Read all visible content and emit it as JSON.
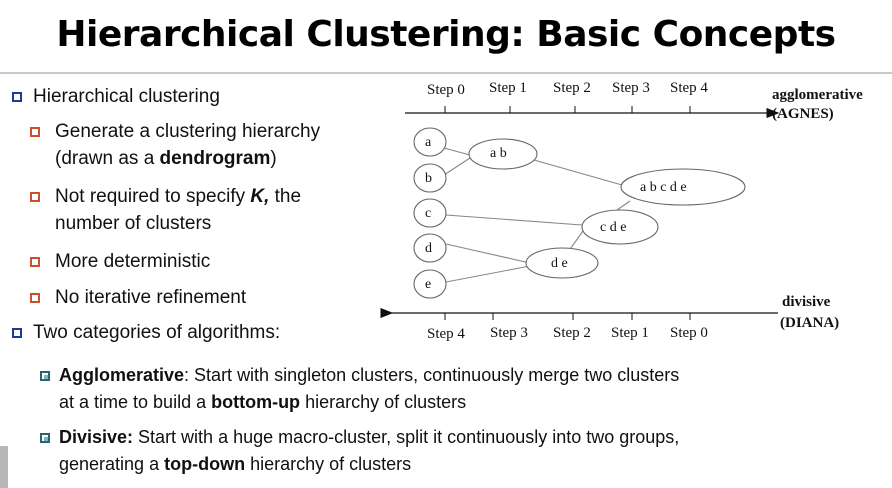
{
  "slide": {
    "title": "Hierarchical Clustering: Basic Concepts",
    "bullets": {
      "main1": "Hierarchical clustering",
      "sub1_line1_pre": "Generate a clustering hierarchy",
      "sub1_line2_pre": "(drawn as a ",
      "sub1_line2_bold": "dendrogram",
      "sub1_line2_post": ")",
      "sub2_line1_pre": "Not required to specify ",
      "sub2_line1_bold": "K,",
      "sub2_line1_post": " the",
      "sub2_line2": "number of clusters",
      "sub3": "More deterministic",
      "sub4": "No iterative refinement",
      "main2": "Two categories of algorithms:",
      "agg_bold": "Agglomerative",
      "agg_line1_rest": ": Start with singleton clusters, continuously merge two clusters",
      "agg_line2_pre": "at a time to build a ",
      "agg_line2_bold": "bottom-up",
      "agg_line2_post": " hierarchy of clusters",
      "div_bold": "Divisive:",
      "div_line1_rest": " Start with a huge macro-cluster, split it continuously into two groups,",
      "div_line2_pre": "generating a ",
      "div_line2_bold": "top-down",
      "div_line2_post": " hierarchy of clusters"
    }
  },
  "diagram": {
    "top_steps": [
      "Step 0",
      "Step 1",
      "Step 2",
      "Step 3",
      "Step 4"
    ],
    "bottom_steps": [
      "Step 4",
      "Step 3",
      "Step 2",
      "Step 1",
      "Step 0"
    ],
    "agglomerative_label": "agglomerative",
    "agnes_label": "(AGNES)",
    "divisive_label": "divisive",
    "diana_label": "(DIANA)",
    "nodes": {
      "a": "a",
      "b": "b",
      "c": "c",
      "d": "d",
      "e": "e",
      "ab": "a b",
      "de": "d e",
      "cde": "c d e",
      "abcde": "a b c d e"
    }
  },
  "colors": {
    "main_bullet": "#1f3a8f",
    "sub_bullet": "#c8532c",
    "algo_bullet": "#25666e",
    "line_gray": "#888888"
  }
}
